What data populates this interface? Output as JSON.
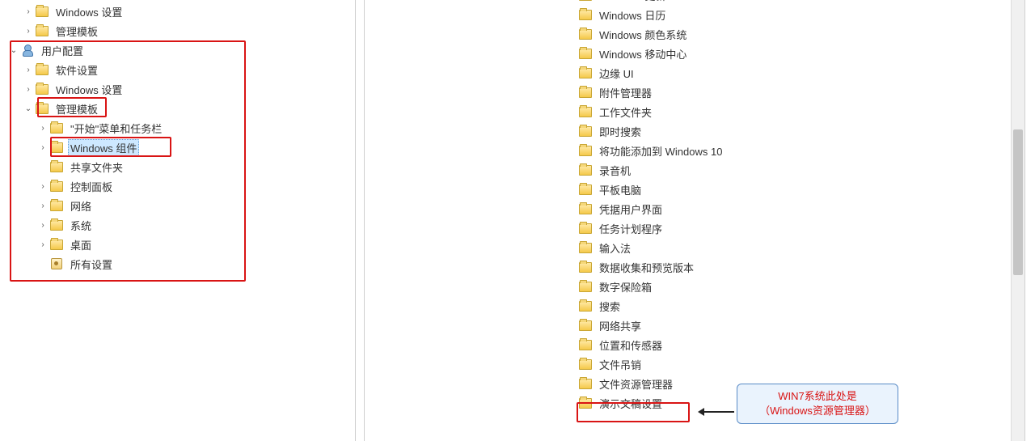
{
  "tree": {
    "items": [
      {
        "depth": 1,
        "caret": "right",
        "icon": "folder",
        "label": "Windows 设置"
      },
      {
        "depth": 1,
        "caret": "right",
        "icon": "folder",
        "label": "管理模板"
      },
      {
        "depth": 0,
        "caret": "down",
        "icon": "user",
        "label": "用户配置"
      },
      {
        "depth": 1,
        "caret": "right",
        "icon": "folder",
        "label": "软件设置"
      },
      {
        "depth": 1,
        "caret": "right",
        "icon": "folder",
        "label": "Windows 设置"
      },
      {
        "depth": 1,
        "caret": "down",
        "icon": "folder",
        "label": "管理模板"
      },
      {
        "depth": 2,
        "caret": "right",
        "icon": "folder",
        "label": "\"开始\"菜单和任务栏"
      },
      {
        "depth": 2,
        "caret": "right",
        "icon": "folder",
        "label": "Windows 组件",
        "selected": true
      },
      {
        "depth": 2,
        "caret": "none",
        "icon": "folder",
        "label": "共享文件夹"
      },
      {
        "depth": 2,
        "caret": "right",
        "icon": "folder",
        "label": "控制面板"
      },
      {
        "depth": 2,
        "caret": "right",
        "icon": "folder",
        "label": "网络"
      },
      {
        "depth": 2,
        "caret": "right",
        "icon": "folder",
        "label": "系统"
      },
      {
        "depth": 2,
        "caret": "right",
        "icon": "folder",
        "label": "桌面"
      },
      {
        "depth": 2,
        "caret": "none",
        "icon": "settings",
        "label": "所有设置"
      }
    ]
  },
  "list": {
    "items": [
      "Windows 更新",
      "Windows 日历",
      "Windows 颜色系统",
      "Windows 移动中心",
      "边缘 UI",
      "附件管理器",
      "工作文件夹",
      "即时搜索",
      "将功能添加到 Windows 10",
      "录音机",
      "平板电脑",
      "凭据用户界面",
      "任务计划程序",
      "输入法",
      "数据收集和预览版本",
      "数字保险箱",
      "搜索",
      "网络共享",
      "位置和传感器",
      "文件吊销",
      "文件资源管理器",
      "演示文稿设置"
    ]
  },
  "annotation": {
    "line1": "WIN7系统此处是",
    "line2": "（Windows资源管理器）"
  }
}
